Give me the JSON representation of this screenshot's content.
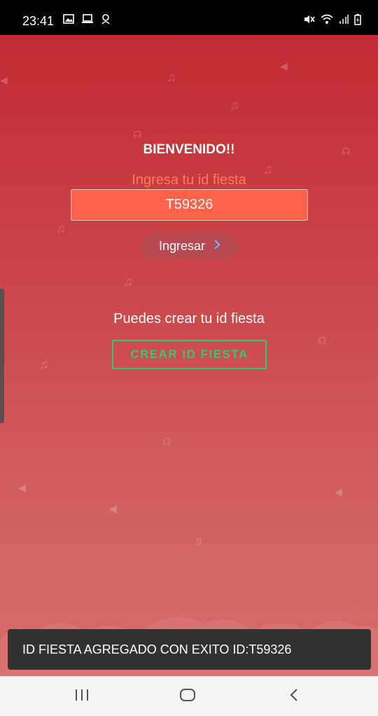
{
  "status_bar": {
    "time": "23:41",
    "left_icons": [
      "image-icon",
      "laptop-icon",
      "notification-icon"
    ],
    "right_icons": [
      "mute-icon",
      "wifi-icon",
      "signal-icon",
      "battery-icon"
    ]
  },
  "main": {
    "welcome": "BIENVENIDO!!",
    "prompt": "Ingresa tu id fiesta",
    "id_value": "T59326",
    "enter_label": "Ingresar",
    "create_text": "Puedes crear tu id fiesta",
    "create_label": "CREAR ID FIESTA"
  },
  "snackbar": {
    "message": "ID FIESTA AGREGADO CON EXITO ID:T59326"
  },
  "nav_bar": {
    "buttons": [
      "recents-icon",
      "home-icon",
      "back-icon"
    ]
  },
  "colors": {
    "background_top": "#c22a32",
    "background_bottom": "#d56a66",
    "input_bg": "#ff6248",
    "prompt_color": "#ff7a5a",
    "create_accent": "#2ecc71",
    "snackbar_bg": "#323232"
  }
}
